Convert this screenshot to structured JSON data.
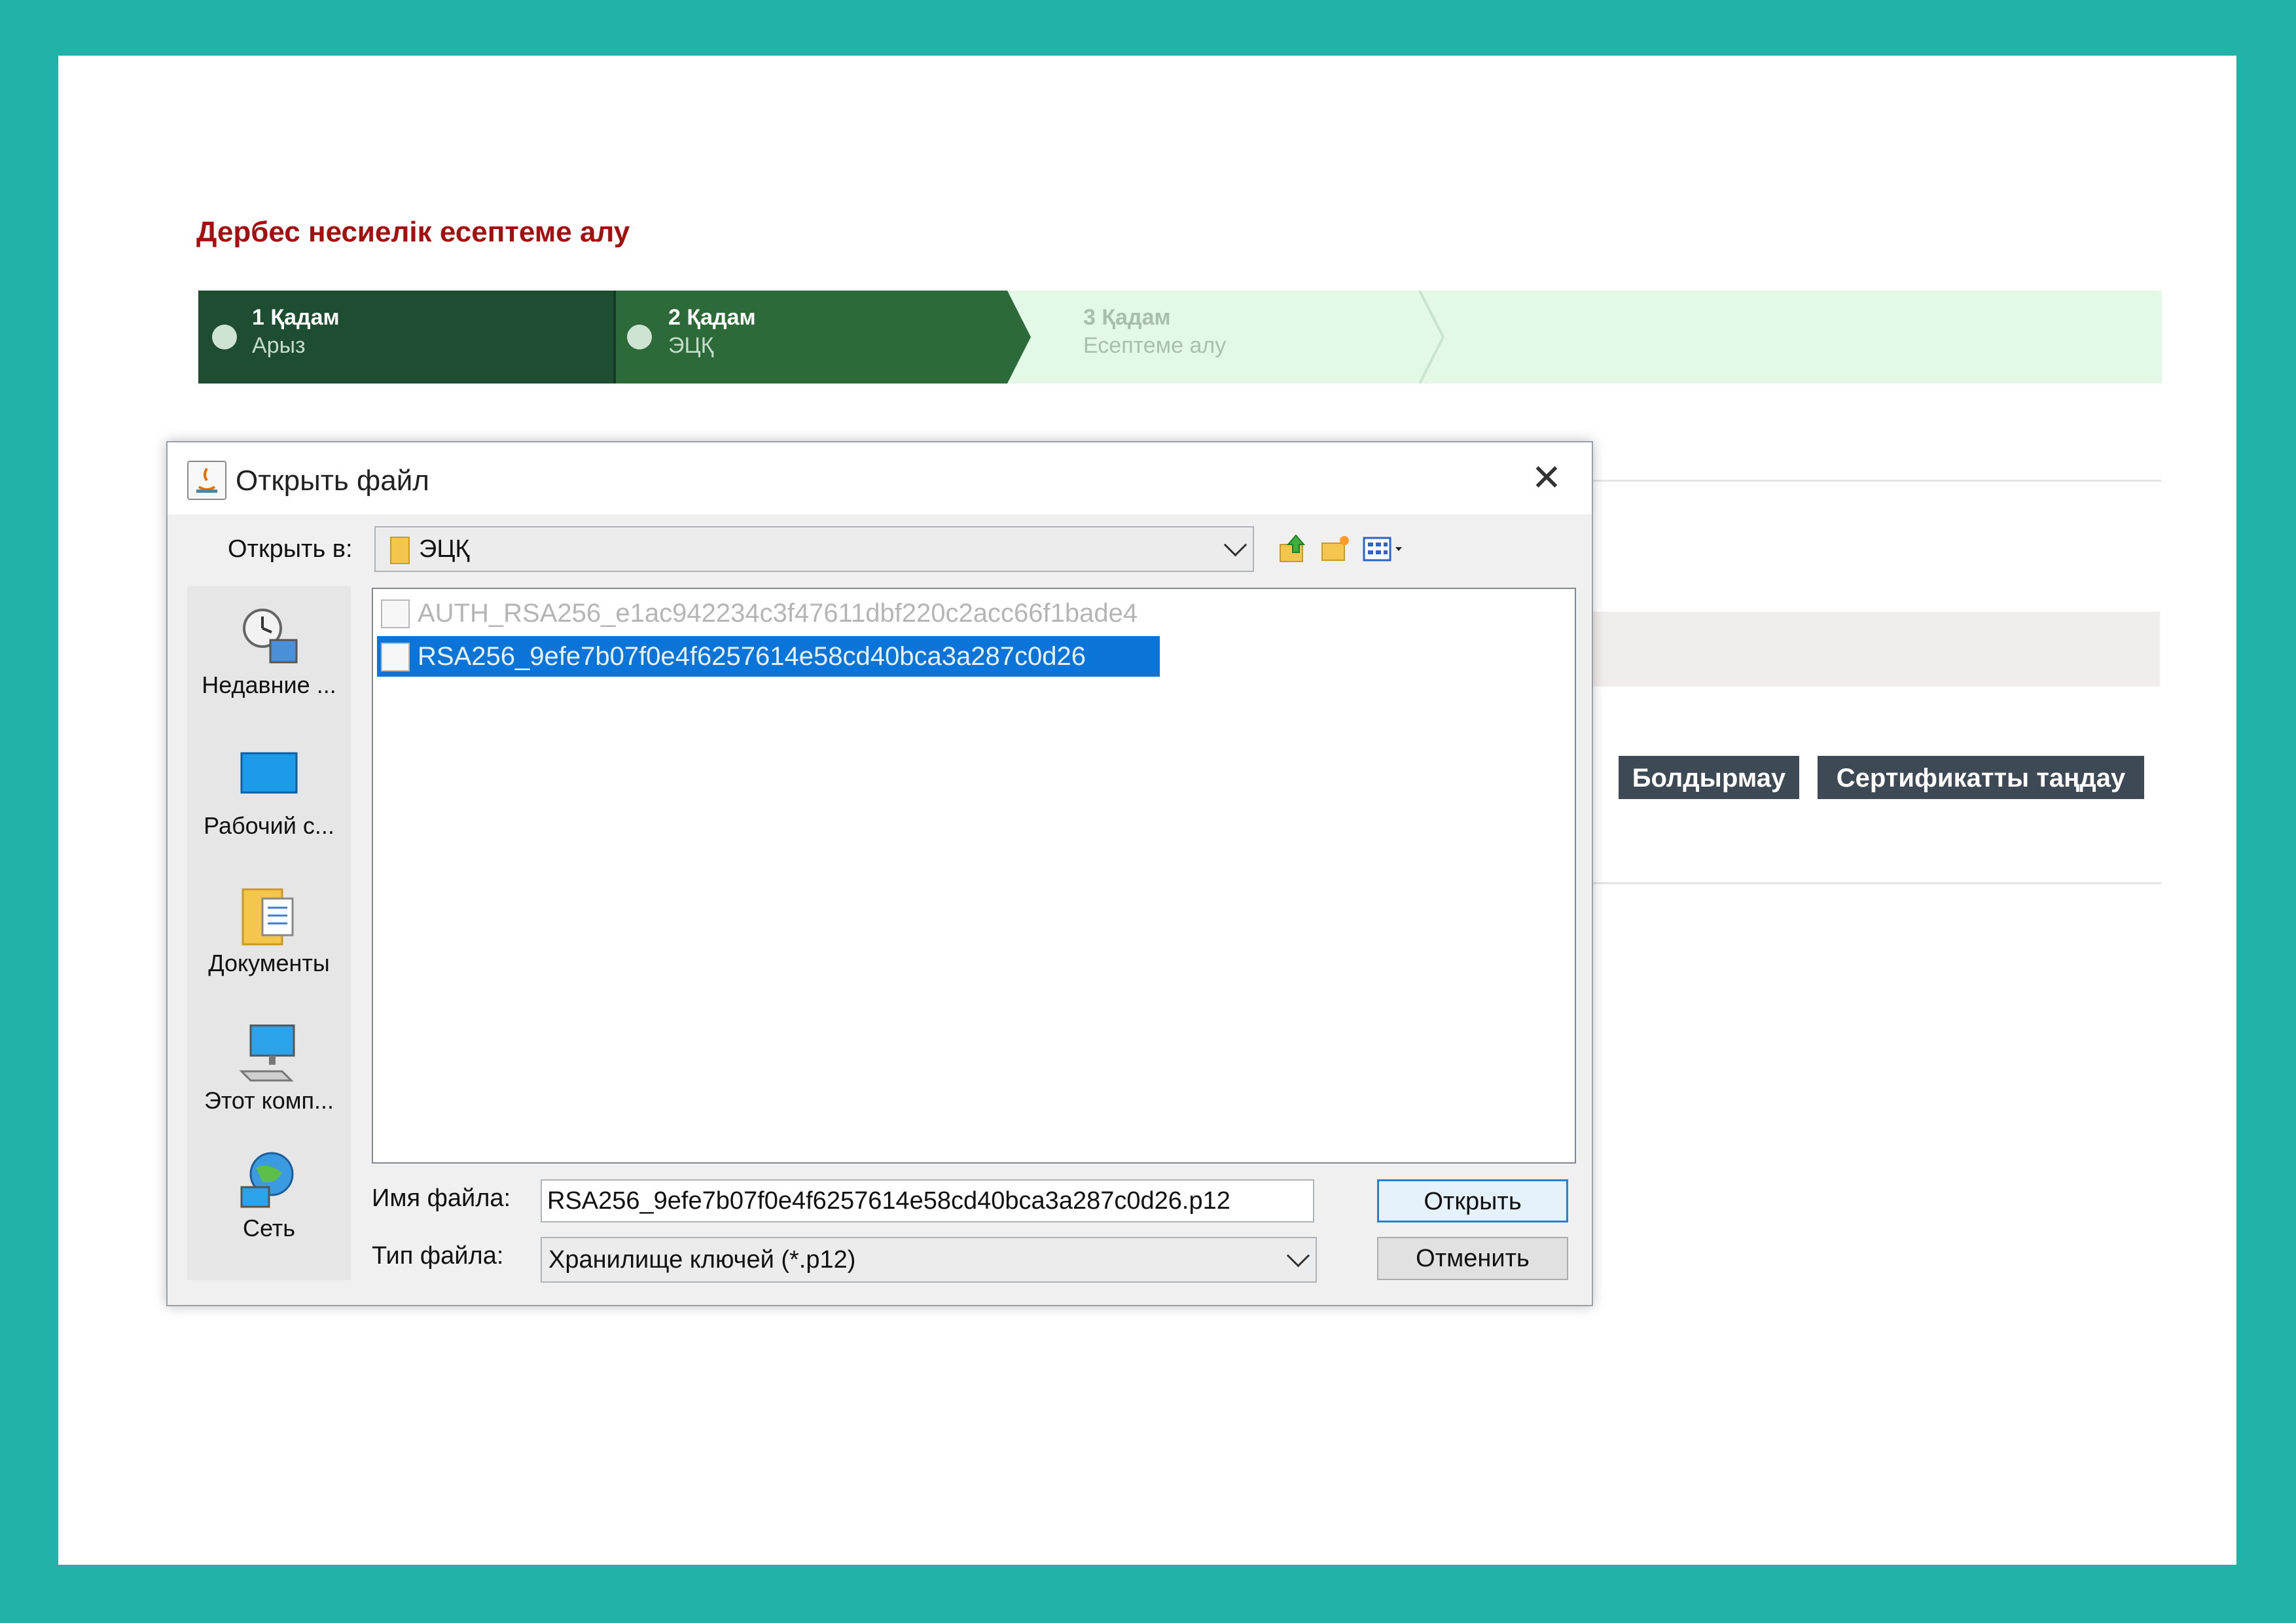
{
  "page": {
    "title": "Дербес несиелік есептеме алу",
    "steps": [
      {
        "title": "1 Қадам",
        "subtitle": "Арыз",
        "state": "done"
      },
      {
        "title": "2 Қадам",
        "subtitle": "ЭЦҚ",
        "state": "active"
      },
      {
        "title": "3 Қадам",
        "subtitle": "Есептеме алу",
        "state": "pending"
      }
    ],
    "buttons": {
      "cancel": "Болдырмау",
      "select_cert": "Сертификатты таңдау"
    },
    "colors": {
      "background": "#22b2a7",
      "title": "#a50e0e",
      "step_done": "#1f4d31",
      "step_active": "#2d6a3a",
      "step_pending": "#e3f8e5",
      "button": "#3d4a55"
    }
  },
  "dialog": {
    "title": "Открыть файл",
    "look_in_label": "Открыть в:",
    "look_in_value": "ЭЦҚ",
    "toolbar_icons": [
      "up-folder-icon",
      "new-folder-icon",
      "view-menu-icon"
    ],
    "places": [
      "Недавние ...",
      "Рабочий с...",
      "Документы",
      "Этот комп...",
      "Сеть"
    ],
    "files": [
      {
        "name": "AUTH_RSA256_e1ac942234c3f47611dbf220c2acc66f1bade4",
        "selected": false
      },
      {
        "name": "RSA256_9efe7b07f0e4f6257614e58cd40bca3a287c0d26",
        "selected": true
      }
    ],
    "file_name_label": "Имя файла:",
    "file_name_value": "RSA256_9efe7b07f0e4f6257614e58cd40bca3a287c0d26.p12",
    "file_type_label": "Тип файла:",
    "file_type_value": "Хранилище ключей (*.p12)",
    "open_button": "Открыть",
    "cancel_button": "Отменить"
  }
}
